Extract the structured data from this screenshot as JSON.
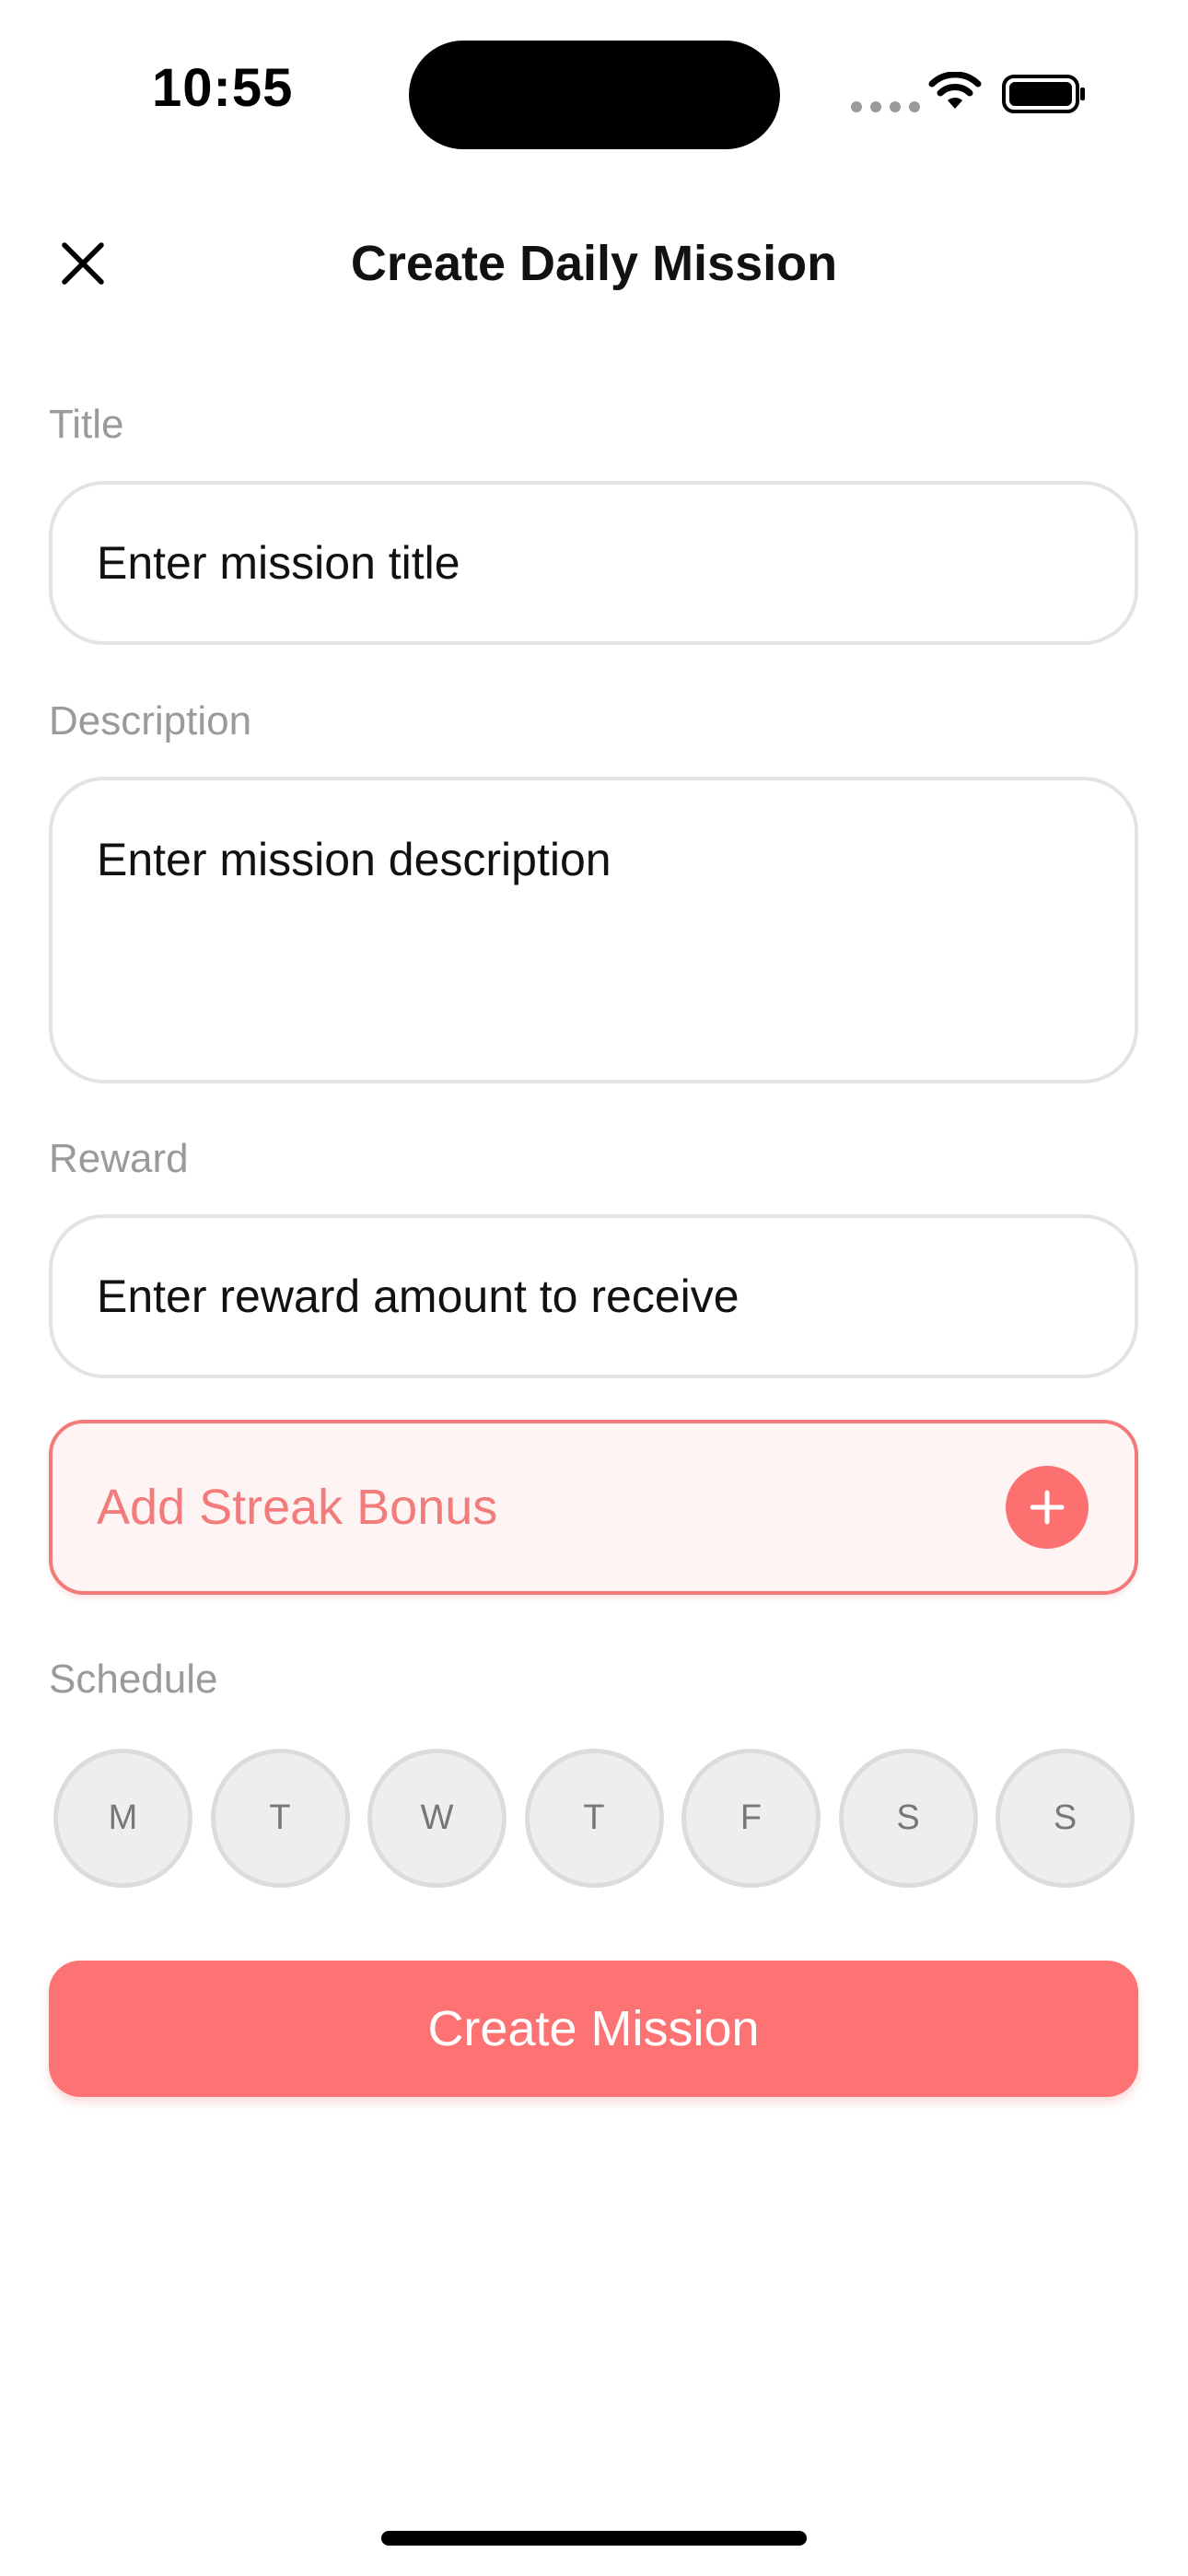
{
  "status_bar": {
    "time": "10:55"
  },
  "header": {
    "title": "Create Daily Mission",
    "close_icon": "close-icon"
  },
  "form": {
    "title": {
      "label": "Title",
      "placeholder": "Enter mission title",
      "value": ""
    },
    "description": {
      "label": "Description",
      "placeholder": "Enter mission description",
      "value": ""
    },
    "reward": {
      "label": "Reward",
      "placeholder": "Enter reward amount to receive",
      "value": ""
    },
    "streak_bonus": {
      "label": "Add Streak Bonus",
      "icon": "plus-icon"
    },
    "schedule": {
      "label": "Schedule",
      "days": [
        {
          "label": "M",
          "selected": false
        },
        {
          "label": "T",
          "selected": false
        },
        {
          "label": "W",
          "selected": false
        },
        {
          "label": "T",
          "selected": false
        },
        {
          "label": "F",
          "selected": false
        },
        {
          "label": "S",
          "selected": false
        },
        {
          "label": "S",
          "selected": false
        }
      ]
    },
    "submit_label": "Create Mission"
  },
  "colors": {
    "accent": "#fd7373",
    "accent_text": "#f27b7b",
    "accent_bg": "#fff4f4",
    "label_gray": "#9a9a9a",
    "border_gray": "#e3e3e3"
  }
}
